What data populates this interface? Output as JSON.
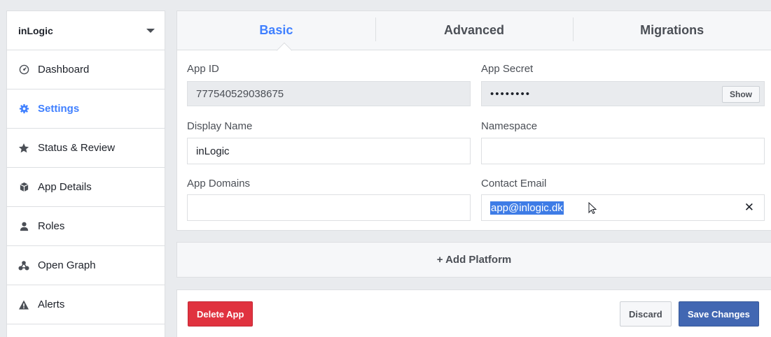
{
  "app_switcher": {
    "name": "inLogic"
  },
  "sidebar": {
    "items": [
      {
        "label": "Dashboard",
        "icon": "dashboard-icon",
        "active": false
      },
      {
        "label": "Settings",
        "icon": "gear-icon",
        "active": true
      },
      {
        "label": "Status & Review",
        "icon": "star-icon",
        "active": false
      },
      {
        "label": "App Details",
        "icon": "cube-icon",
        "active": false
      },
      {
        "label": "Roles",
        "icon": "person-icon",
        "active": false
      },
      {
        "label": "Open Graph",
        "icon": "graph-icon",
        "active": false
      },
      {
        "label": "Alerts",
        "icon": "warning-icon",
        "active": false
      }
    ]
  },
  "tabs": [
    {
      "label": "Basic",
      "active": true
    },
    {
      "label": "Advanced",
      "active": false
    },
    {
      "label": "Migrations",
      "active": false
    }
  ],
  "form": {
    "app_id": {
      "label": "App ID",
      "value": "777540529038675"
    },
    "app_secret": {
      "label": "App Secret",
      "value": "••••••••",
      "show_label": "Show"
    },
    "display_name": {
      "label": "Display Name",
      "value": "inLogic"
    },
    "namespace": {
      "label": "Namespace",
      "value": ""
    },
    "app_domains": {
      "label": "App Domains",
      "value": ""
    },
    "contact_email": {
      "label": "Contact Email",
      "value": "app@inlogic.dk",
      "clear_symbol": "✕"
    }
  },
  "platform": {
    "label": "+ Add Platform"
  },
  "actions": {
    "delete_label": "Delete App",
    "discard_label": "Discard",
    "save_label": "Save Changes"
  },
  "colors": {
    "accent": "#4080ff",
    "danger": "#e0323f",
    "primary": "#4267b2",
    "selection": "#3e7ce6"
  }
}
